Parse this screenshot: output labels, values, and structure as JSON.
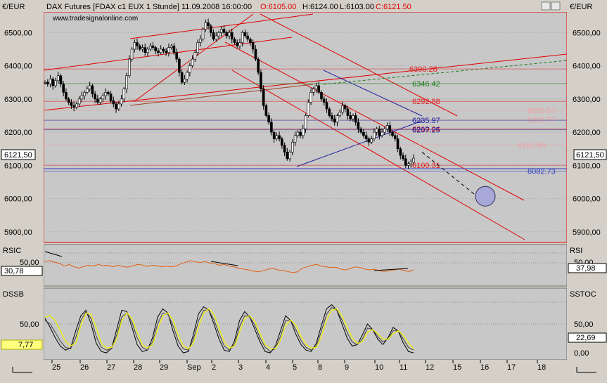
{
  "header": {
    "instrument": "DAX Futures [FDAX c1 EUX  1 Stunde] 11.09.2008 16:00:00",
    "open": "O:6105.00",
    "high": "H:6124.00",
    "low": "L:6103.00",
    "close": "C:6121.50",
    "watermark": "www.tradesignalonline.com"
  },
  "axis_unit": "€/EUR",
  "price_axis": {
    "ticks": [
      "6500,00",
      "6400,00",
      "6300,00",
      "6200,00",
      "6100,00",
      "6000,00",
      "5900,00"
    ],
    "current_left": "6121,50",
    "current_right": "6121,50"
  },
  "price_levels": [
    {
      "label": "6390.28",
      "value": 6390.28,
      "color": "#e02020"
    },
    {
      "label": "6346.42",
      "value": 6346.42,
      "color": "#1a7a1a"
    },
    {
      "label": "6292.88",
      "value": 6292.88,
      "color": "#e02020"
    },
    {
      "label": "6265.57",
      "value": 6265.57,
      "color": "#f0a0a0"
    },
    {
      "label": "6236.77",
      "value": 6236.77,
      "color": "#f0a0a0"
    },
    {
      "label": "6235.97",
      "value": 6235.97,
      "color": "#2020a0"
    },
    {
      "label": "6210.04",
      "value": 6210.04,
      "color": "#e02020"
    },
    {
      "label": "6207.25",
      "value": 6207.25,
      "color": "#2020a0"
    },
    {
      "label": "6161.84",
      "value": 6161.84,
      "color": "#f0a0a0"
    },
    {
      "label": "6100.31",
      "value": 6100.31,
      "color": "#e02020"
    },
    {
      "label": "6082.73",
      "value": 6082.73,
      "color": "#3040c0"
    }
  ],
  "rsi_panel": {
    "left_label": "RSIC",
    "right_label": "RSI",
    "tick": "50,00",
    "left_value": "30,78",
    "right_value": "37,98"
  },
  "stoch_panel": {
    "left_label": "DSSB",
    "right_label": "SSTOC",
    "ticks": [
      "50,00",
      "0,00"
    ],
    "left_value": "7,77",
    "right_value": "22,69"
  },
  "x_axis": {
    "labels": [
      "25",
      "26",
      "27",
      "28",
      "29",
      "Sep",
      "2",
      "3",
      "4",
      "5",
      "8",
      "9",
      "10",
      "11",
      "12",
      "15",
      "16",
      "17",
      "18"
    ]
  },
  "chart_data": {
    "type": "candlestick",
    "ylim": [
      5870,
      6560
    ],
    "close_series": [
      6350,
      6345,
      6360,
      6340,
      6355,
      6370,
      6345,
      6320,
      6300,
      6290,
      6280,
      6275,
      6285,
      6300,
      6310,
      6320,
      6330,
      6340,
      6315,
      6300,
      6290,
      6300,
      6310,
      6320,
      6315,
      6295,
      6285,
      6270,
      6285,
      6300,
      6330,
      6370,
      6420,
      6450,
      6470,
      6460,
      6450,
      6455,
      6440,
      6450,
      6460,
      6455,
      6445,
      6440,
      6450,
      6445,
      6440,
      6455,
      6460,
      6440,
      6420,
      6380,
      6350,
      6360,
      6380,
      6400,
      6420,
      6440,
      6470,
      6480,
      6510,
      6530,
      6520,
      6500,
      6480,
      6490,
      6500,
      6510,
      6500,
      6490,
      6500,
      6480,
      6470,
      6460,
      6470,
      6500,
      6490,
      6480,
      6470,
      6450,
      6420,
      6380,
      6330,
      6280,
      6250,
      6230,
      6200,
      6180,
      6190,
      6180,
      6160,
      6140,
      6120,
      6140,
      6170,
      6190,
      6200,
      6190,
      6210,
      6250,
      6290,
      6320,
      6330,
      6340,
      6320,
      6300,
      6290,
      6270,
      6250,
      6240,
      6230,
      6250,
      6260,
      6280,
      6270,
      6250,
      6240,
      6250,
      6230,
      6210,
      6200,
      6190,
      6180,
      6170,
      6180,
      6200,
      6210,
      6190,
      6200,
      6210,
      6220,
      6200,
      6190,
      6180,
      6150,
      6130,
      6120,
      6100,
      6105,
      6110,
      6121.5
    ],
    "dashed_projection": {
      "from": 6140,
      "to": 5990
    },
    "target_circle": 5990,
    "rsi_series": [
      60,
      62,
      58,
      55,
      48,
      52,
      46,
      43,
      47,
      50,
      48,
      52,
      49,
      50,
      46,
      50,
      47,
      45,
      48,
      52,
      51,
      47,
      50,
      49,
      46,
      48,
      46,
      48,
      54,
      58,
      62,
      59,
      57,
      60,
      56,
      54,
      50,
      52,
      48,
      46,
      42,
      40,
      38,
      35,
      33,
      36,
      40,
      42,
      38,
      37,
      34,
      31,
      33,
      42,
      46,
      50,
      52,
      48,
      46,
      44,
      45,
      40,
      38,
      42,
      46,
      44,
      40,
      38,
      40,
      36,
      34,
      36,
      38,
      40,
      37,
      34,
      38
    ],
    "stoch_series": [
      [
        58,
        45,
        30,
        18,
        12,
        15,
        40,
        62,
        70,
        50,
        22,
        10,
        8,
        15,
        42,
        70,
        68,
        45,
        20,
        10,
        12,
        30,
        60,
        72,
        66,
        40,
        18,
        8,
        10,
        35,
        65,
        75,
        70,
        50,
        28,
        12,
        10,
        25,
        55,
        68,
        60,
        42,
        24,
        10,
        8,
        18,
        40,
        62,
        55,
        35,
        20,
        12,
        10,
        22,
        48,
        72,
        78,
        70,
        50,
        30,
        18,
        20,
        34,
        50,
        42,
        28,
        20,
        30,
        45,
        40,
        22,
        10,
        8
      ],
      [
        55,
        50,
        38,
        25,
        16,
        14,
        30,
        55,
        68,
        58,
        32,
        16,
        12,
        14,
        34,
        60,
        66,
        52,
        30,
        16,
        12,
        24,
        50,
        66,
        64,
        48,
        26,
        14,
        12,
        28,
        55,
        70,
        70,
        56,
        36,
        18,
        12,
        20,
        46,
        62,
        60,
        48,
        30,
        16,
        10,
        14,
        32,
        55,
        55,
        42,
        26,
        16,
        12,
        18,
        40,
        64,
        74,
        70,
        56,
        38,
        24,
        20,
        28,
        44,
        42,
        32,
        24,
        28,
        40,
        40,
        28,
        16,
        12
      ],
      [
        60,
        62,
        55,
        40,
        25,
        18,
        22,
        48,
        66,
        64,
        44,
        22,
        15,
        16,
        28,
        55,
        66,
        58,
        38,
        20,
        15,
        20,
        42,
        62,
        66,
        56,
        34,
        18,
        14,
        22,
        46,
        66,
        72,
        64,
        44,
        24,
        15,
        18,
        38,
        58,
        62,
        54,
        36,
        20,
        14,
        14,
        26,
        48,
        56,
        48,
        32,
        20,
        15,
        16,
        32,
        56,
        70,
        72,
        62,
        46,
        30,
        22,
        24,
        38,
        42,
        36,
        28,
        28,
        36,
        40,
        34,
        22,
        14
      ]
    ]
  }
}
